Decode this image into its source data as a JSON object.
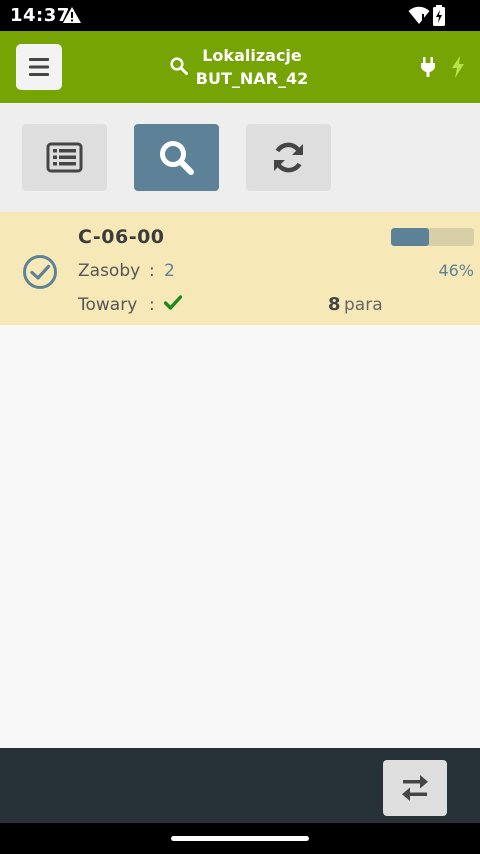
{
  "status_bar": {
    "time": "14:37"
  },
  "header": {
    "title_line1": "Lokalizacje",
    "title_line2": "BUT_NAR_42",
    "color": "#75a404"
  },
  "toolbar": {
    "buttons": [
      {
        "icon": "list-icon",
        "active": false
      },
      {
        "icon": "search-icon",
        "active": true
      },
      {
        "icon": "refresh-icon",
        "active": false
      }
    ],
    "active_color": "#5d8297"
  },
  "location_row": {
    "code": "C-06-00",
    "zasoby_label": "Zasoby",
    "colon": ":",
    "zasoby_value": "2",
    "towary_label": "Towary",
    "quantity": "8",
    "unit": "para",
    "progress_percent": 46,
    "progress_label": "46%",
    "status_icon": "check-circle-icon",
    "towary_icon": "checkmark-icon",
    "background": "#f7e9b7"
  },
  "bottom_bar": {
    "action_icon": "swap-arrows-icon",
    "color": "#263238"
  }
}
